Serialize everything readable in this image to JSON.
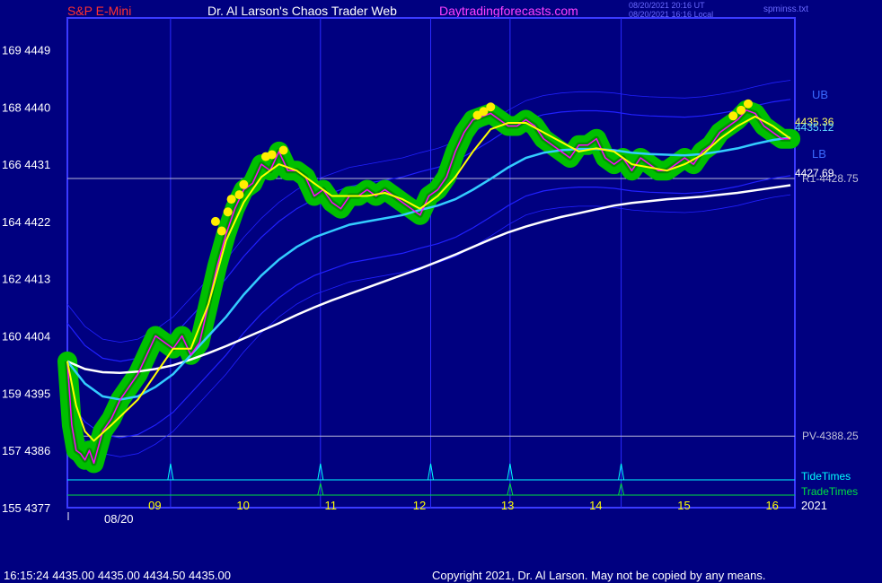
{
  "header": {
    "symbol": "S&P E-Mini",
    "title": "Dr. Al Larson's Chaos Trader Web",
    "site": "Daytradingforecasts.com",
    "stamp_utc": "08/20/2021 20:16 UT",
    "stamp_local": "08/20/2021 16:16 Local",
    "file": "spminss.txt"
  },
  "footer": {
    "quote": "16:15:24  4435.00 4435.00 4434.50 4435.00",
    "copyright": "Copyright 2021, Dr. Al Larson. May not be copied by any means."
  },
  "colors": {
    "background": "#000080",
    "frame": "#3a3aff",
    "price": "#ff00ff",
    "green_band": "#00c000",
    "yellow_line": "#ffff00",
    "cyan_line": "#33ccff",
    "white_line": "#ffffff",
    "blue_band": "#2020ff",
    "tide": "#00ffff",
    "trade": "#00e040",
    "dots": "#ffee00"
  },
  "chart_data": {
    "type": "line",
    "title": "S&P E-Mini",
    "x_unit": "hour",
    "xlim": [
      8.0,
      16.25
    ],
    "ylim": [
      4377,
      4454
    ],
    "date_label": "08/20",
    "year_label": "2021",
    "y_ticks": [
      {
        "value": 4449,
        "label": "169  4449"
      },
      {
        "value": 4440,
        "label": "168  4440"
      },
      {
        "value": 4431,
        "label": "166  4431"
      },
      {
        "value": 4422,
        "label": "164  4422"
      },
      {
        "value": 4413,
        "label": "162  4413"
      },
      {
        "value": 4404,
        "label": "160  4404"
      },
      {
        "value": 4395,
        "label": "159  4395"
      },
      {
        "value": 4386,
        "label": "157  4386"
      },
      {
        "value": 4377,
        "label": "155  4377"
      }
    ],
    "x_ticks": [
      {
        "x": 9,
        "label": "09"
      },
      {
        "x": 10,
        "label": "10"
      },
      {
        "x": 11,
        "label": "11"
      },
      {
        "x": 12,
        "label": "12"
      },
      {
        "x": 13,
        "label": "13"
      },
      {
        "x": 14,
        "label": "14"
      },
      {
        "x": 15,
        "label": "15"
      },
      {
        "x": 16,
        "label": "16"
      }
    ],
    "vertical_time_lines": [
      9.17,
      10.87,
      12.12,
      13.02,
      14.28
    ],
    "tide_times": [
      9.17,
      10.87,
      12.12,
      13.02,
      14.28
    ],
    "trade_times": [
      10.87,
      13.02,
      14.28
    ],
    "levels": [
      {
        "name": "R1",
        "value": 4428.75,
        "label": "R1-4428.75"
      },
      {
        "name": "PV",
        "value": 4388.25,
        "label": "PV-4388.25"
      }
    ],
    "band_labels": {
      "upper": "UB",
      "lower": "LB"
    },
    "row_labels": {
      "tide": "TideTimes",
      "trade": "TradeTimes"
    },
    "last_values": [
      {
        "label": "4435.36",
        "value": 4435.36
      },
      {
        "label": "4435.12",
        "value": 4434.8
      },
      {
        "label": "4427.69",
        "value": 4427.69
      }
    ],
    "series": [
      {
        "name": "price",
        "x": [
          8.0,
          8.05,
          8.1,
          8.15,
          8.2,
          8.25,
          8.3,
          8.4,
          8.5,
          8.6,
          8.7,
          8.8,
          8.9,
          9.0,
          9.1,
          9.2,
          9.3,
          9.4,
          9.5,
          9.6,
          9.7,
          9.8,
          9.9,
          10.0,
          10.1,
          10.2,
          10.3,
          10.4,
          10.5,
          10.6,
          10.7,
          10.8,
          10.9,
          11.0,
          11.1,
          11.2,
          11.3,
          11.4,
          11.5,
          11.6,
          11.7,
          11.8,
          11.9,
          12.0,
          12.1,
          12.2,
          12.3,
          12.4,
          12.5,
          12.6,
          12.7,
          12.8,
          12.9,
          13.0,
          13.1,
          13.2,
          13.3,
          13.4,
          13.5,
          13.6,
          13.7,
          13.8,
          13.9,
          14.0,
          14.1,
          14.2,
          14.3,
          14.4,
          14.5,
          14.6,
          14.7,
          14.8,
          14.9,
          15.0,
          15.1,
          15.2,
          15.3,
          15.4,
          15.5,
          15.6,
          15.7,
          15.8,
          15.9,
          16.0,
          16.1,
          16.2
        ],
        "y": [
          4400,
          4390,
          4386,
          4385.5,
          4384.5,
          4386,
          4384,
          4389,
          4391,
          4394,
          4396,
          4398,
          4401,
          4404,
          4403,
          4402,
          4404,
          4401,
          4403,
          4409,
          4415,
          4420,
          4424,
          4427,
          4428,
          4431,
          4430,
          4433,
          4430,
          4430,
          4429,
          4426,
          4427,
          4425,
          4424,
          4426,
          4426,
          4427,
          4426,
          4427,
          4426,
          4425,
          4424,
          4423,
          4426,
          4427,
          4429,
          4433,
          4436,
          4438,
          4438.5,
          4439,
          4438,
          4437,
          4437,
          4438,
          4437,
          4435,
          4434,
          4433,
          4432,
          4434,
          4434,
          4435,
          4432,
          4431,
          4432,
          4430,
          4432,
          4431,
          4430,
          4430,
          4431,
          4432,
          4431,
          4433,
          4434,
          4436,
          4437,
          4438,
          4439.5,
          4439,
          4437,
          4436,
          4435,
          4435
        ]
      },
      {
        "name": "yellow",
        "x": [
          8.0,
          8.1,
          8.2,
          8.3,
          8.5,
          8.8,
          9.0,
          9.2,
          9.4,
          9.6,
          9.8,
          10.0,
          10.2,
          10.4,
          10.6,
          10.8,
          11.0,
          11.2,
          11.4,
          11.6,
          11.8,
          12.0,
          12.2,
          12.4,
          12.6,
          12.8,
          13.0,
          13.2,
          13.4,
          13.6,
          13.8,
          14.0,
          14.2,
          14.4,
          14.6,
          14.8,
          15.0,
          15.2,
          15.4,
          15.6,
          15.8,
          16.0,
          16.2
        ],
        "y": [
          4400,
          4393,
          4389,
          4387.5,
          4390,
          4394,
          4398,
          4402,
          4402,
          4409,
          4419,
          4425,
          4429,
          4431,
          4430,
          4428,
          4426,
          4426,
          4426,
          4426.5,
          4425.5,
          4424,
          4426,
          4429,
          4433,
          4436.5,
          4437.5,
          4437.5,
          4436,
          4434.5,
          4433,
          4433.5,
          4433,
          4431,
          4430.5,
          4430,
          4431,
          4432.5,
          4435,
          4437,
          4438.5,
          4437,
          4435
        ]
      },
      {
        "name": "cyan",
        "x": [
          8.0,
          8.2,
          8.4,
          8.6,
          8.8,
          9.0,
          9.2,
          9.4,
          9.6,
          9.8,
          10.0,
          10.2,
          10.4,
          10.6,
          10.8,
          11.0,
          11.2,
          11.4,
          11.6,
          11.8,
          12.0,
          12.2,
          12.4,
          12.6,
          12.8,
          13.0,
          13.2,
          13.4,
          13.6,
          13.8,
          14.0,
          14.2,
          14.4,
          14.6,
          14.8,
          15.0,
          15.2,
          15.4,
          15.6,
          15.8,
          16.0,
          16.2
        ],
        "y": [
          4400,
          4396.5,
          4394.5,
          4394,
          4394.5,
          4396,
          4398,
          4401,
          4404,
          4407,
          4410.5,
          4413.5,
          4416,
          4418,
          4419.5,
          4420.5,
          4421.5,
          4422,
          4422.5,
          4423,
          4423.8,
          4424.5,
          4425.5,
          4427,
          4428.7,
          4430.5,
          4432,
          4432.8,
          4433.2,
          4433.4,
          4433.4,
          4433.2,
          4432.8,
          4432.6,
          4432.5,
          4432.4,
          4432.6,
          4433,
          4433.5,
          4434.2,
          4434.8,
          4435.2
        ]
      },
      {
        "name": "white",
        "x": [
          8.0,
          8.2,
          8.4,
          8.6,
          8.8,
          9.0,
          9.2,
          9.4,
          9.6,
          9.8,
          10.0,
          10.2,
          10.4,
          10.6,
          10.8,
          11.0,
          11.2,
          11.4,
          11.6,
          11.8,
          12.0,
          12.2,
          12.4,
          12.6,
          12.8,
          13.0,
          13.2,
          13.4,
          13.6,
          13.8,
          14.0,
          14.2,
          14.4,
          14.6,
          14.8,
          15.0,
          15.2,
          15.4,
          15.6,
          15.8,
          16.0,
          16.2
        ],
        "y": [
          4400,
          4398.8,
          4398.3,
          4398.2,
          4398.4,
          4398.8,
          4399.4,
          4400.3,
          4401.3,
          4402.4,
          4403.6,
          4404.8,
          4406.0,
          4407.3,
          4408.5,
          4409.6,
          4410.6,
          4411.6,
          4412.6,
          4413.6,
          4414.6,
          4415.7,
          4416.8,
          4418.0,
          4419.2,
          4420.3,
          4421.2,
          4422.0,
          4422.7,
          4423.3,
          4423.9,
          4424.5,
          4424.9,
          4425.2,
          4425.5,
          4425.7,
          4425.9,
          4426.2,
          4426.5,
          4426.9,
          4427.3,
          4427.7
        ]
      }
    ],
    "highlight_dots": [
      {
        "x": 9.68,
        "y": 4422
      },
      {
        "x": 9.75,
        "y": 4420.5
      },
      {
        "x": 9.82,
        "y": 4423.5
      },
      {
        "x": 9.86,
        "y": 4425.5
      },
      {
        "x": 9.95,
        "y": 4426.2
      },
      {
        "x": 10.0,
        "y": 4427.8
      },
      {
        "x": 10.25,
        "y": 4432.2
      },
      {
        "x": 10.32,
        "y": 4432.5
      },
      {
        "x": 10.45,
        "y": 4433.2
      },
      {
        "x": 12.65,
        "y": 4438.7
      },
      {
        "x": 12.72,
        "y": 4439.3
      },
      {
        "x": 12.8,
        "y": 4440.0
      },
      {
        "x": 15.55,
        "y": 4438.6
      },
      {
        "x": 15.64,
        "y": 4439.5
      },
      {
        "x": 15.72,
        "y": 4440.5
      }
    ]
  }
}
